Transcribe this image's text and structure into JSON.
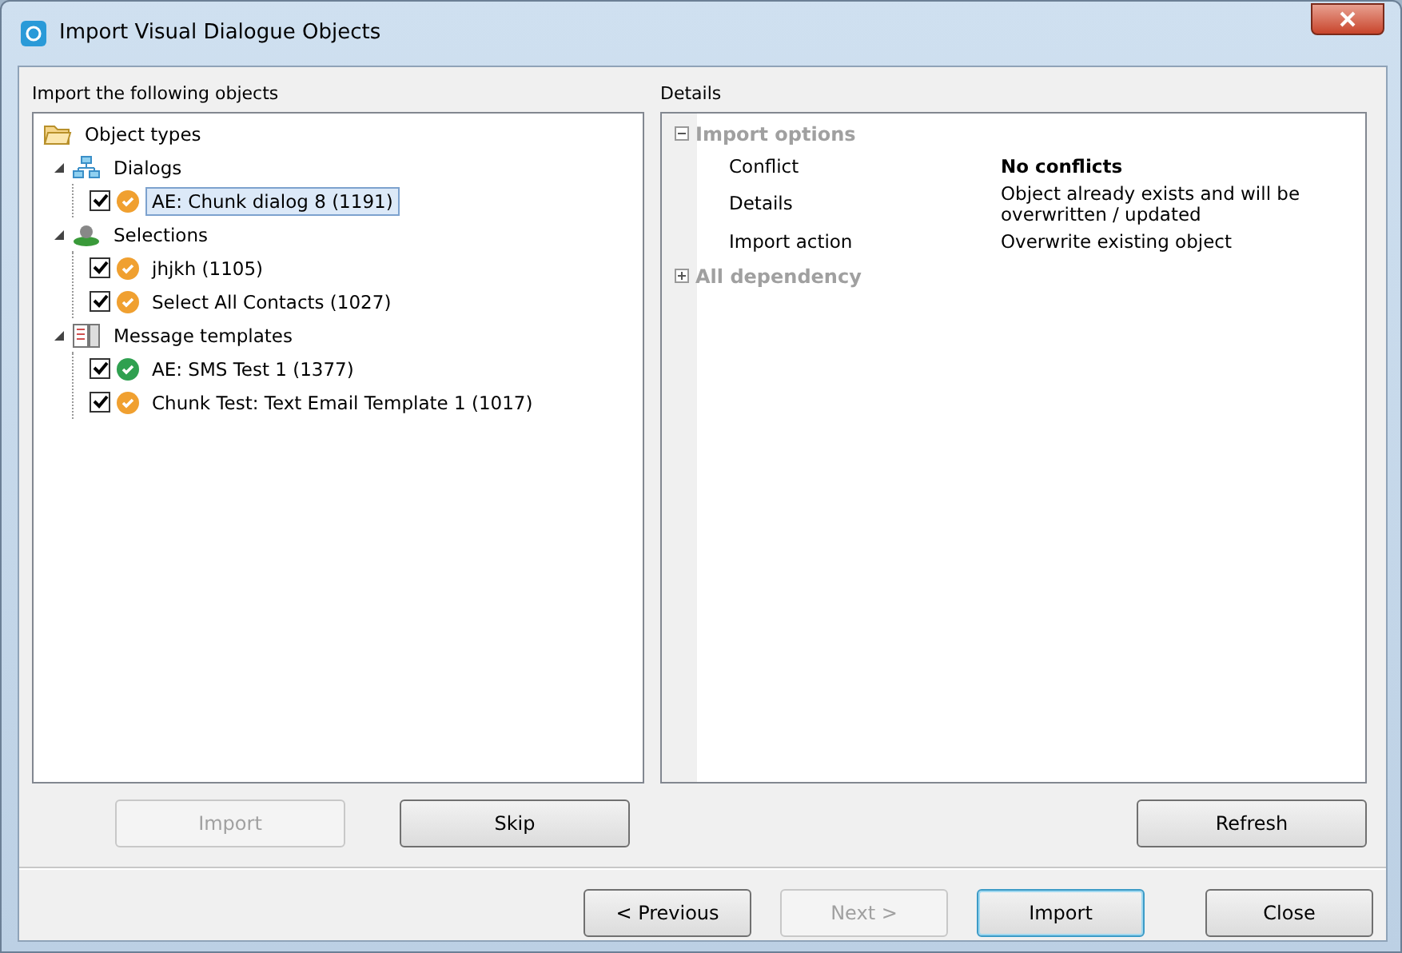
{
  "window": {
    "title": "Import Visual Dialogue Objects"
  },
  "objects_panel": {
    "label": "Import the following objects",
    "tree": [
      {
        "label": "Object types",
        "kind": "folder",
        "children": [
          {
            "label": "Dialogs",
            "kind": "dialogs",
            "expanded": true,
            "children": [
              {
                "label": "AE: Chunk dialog 8 (1191)",
                "kind": "object",
                "checked": true,
                "color": "#f0a030",
                "selected": true
              }
            ]
          },
          {
            "label": "Selections",
            "kind": "selections",
            "expanded": true,
            "children": [
              {
                "label": "jhjkh (1105)",
                "kind": "object",
                "checked": true,
                "color": "#f0a030",
                "selected": false
              },
              {
                "label": "Select All Contacts (1027)",
                "kind": "object",
                "checked": true,
                "color": "#f0a030",
                "selected": false
              }
            ]
          },
          {
            "label": "Message templates",
            "kind": "templates",
            "expanded": true,
            "children": [
              {
                "label": "AE: SMS Test 1 (1377)",
                "kind": "object",
                "checked": true,
                "color": "#2fa050",
                "selected": false
              },
              {
                "label": "Chunk Test: Text Email Template 1 (1017)",
                "kind": "object",
                "checked": true,
                "color": "#f0a030",
                "selected": false
              }
            ]
          }
        ]
      }
    ],
    "buttons": [
      {
        "label": "Import",
        "disabled": true
      },
      {
        "label": "Skip",
        "disabled": false
      }
    ]
  },
  "details_panel": {
    "label": "Details",
    "categories": [
      {
        "label": "Import options",
        "expanded": true,
        "properties": [
          {
            "name": "Conflict",
            "value": "No conflicts",
            "bold": true
          },
          {
            "name": "Details",
            "value": "Object already exists and will be overwritten / updated",
            "bold": false
          },
          {
            "name": "Import action",
            "value": "Overwrite existing object",
            "bold": false
          }
        ]
      },
      {
        "label": "All dependency",
        "expanded": false
      }
    ],
    "buttons": [
      {
        "label": "Refresh",
        "disabled": false
      }
    ]
  },
  "footer_buttons": [
    {
      "label": "< Previous",
      "disabled": false,
      "default": false
    },
    {
      "label": "Next >",
      "disabled": true,
      "default": false
    },
    {
      "label": "Import",
      "disabled": false,
      "default": true
    },
    {
      "label": "Close",
      "disabled": false,
      "default": false
    }
  ]
}
